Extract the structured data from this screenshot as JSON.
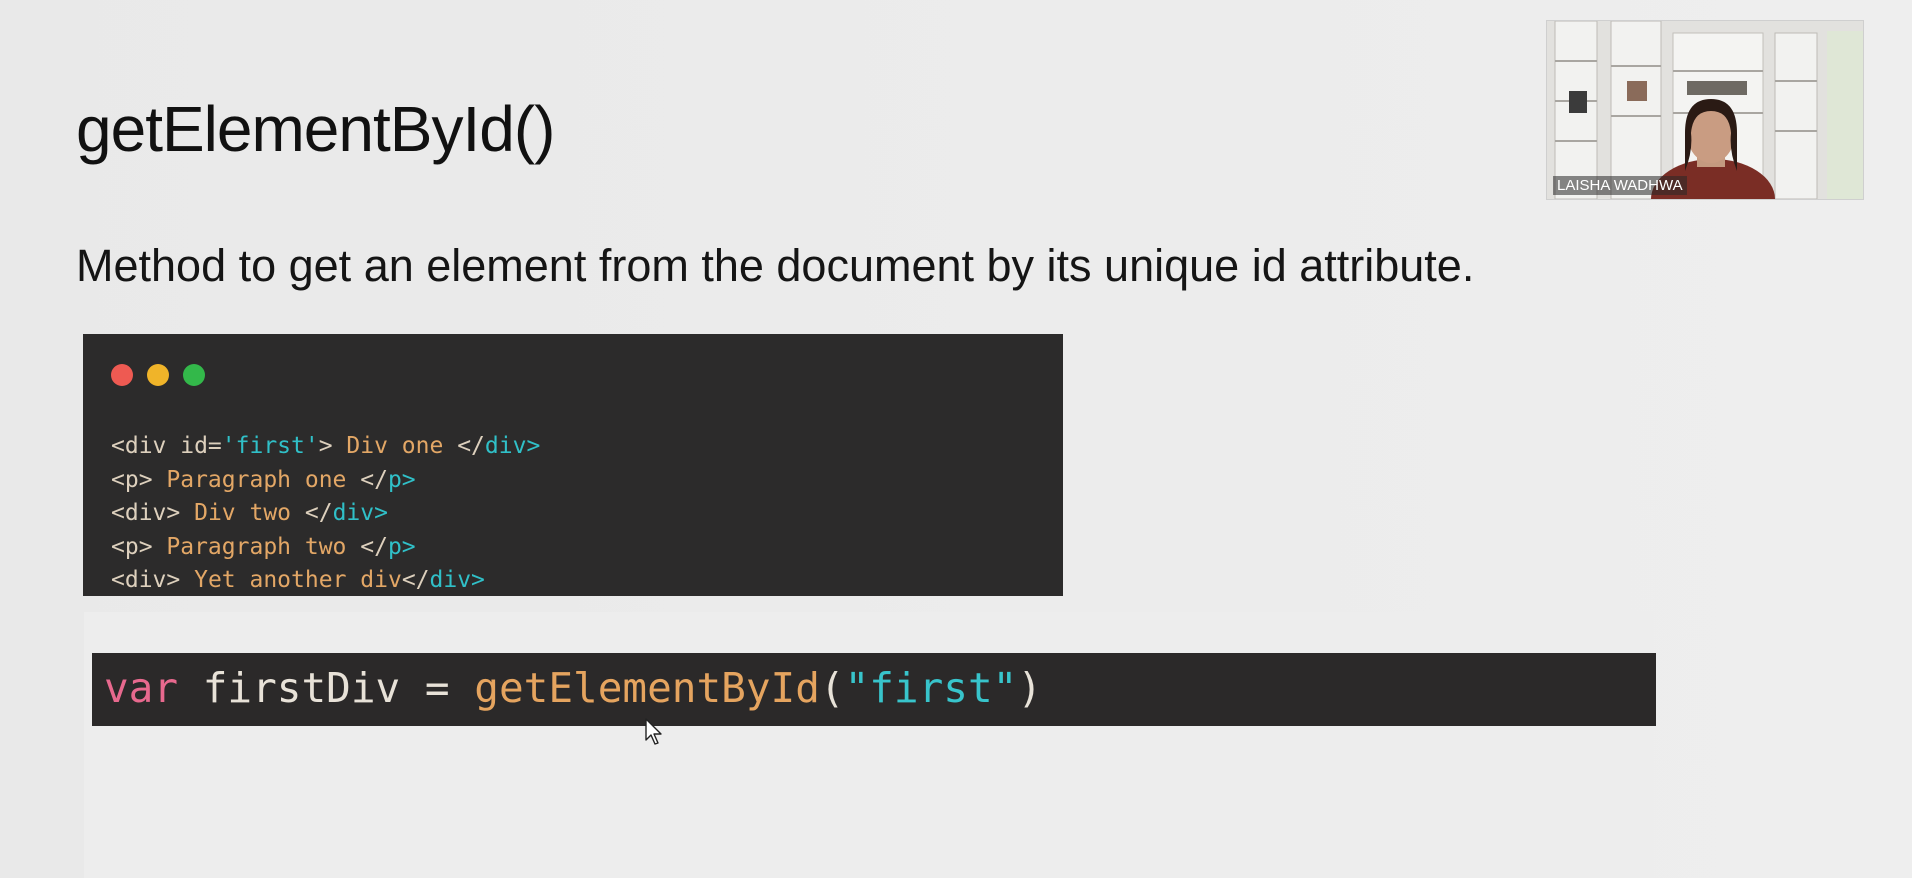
{
  "slide": {
    "title": "getElementById()",
    "subtitle": "Method to get an element from the document by its unique id attribute."
  },
  "code_window": {
    "lines": [
      [
        {
          "t": "<div id=",
          "c": "plain"
        },
        {
          "t": "'first'",
          "c": "str"
        },
        {
          "t": "> ",
          "c": "plain"
        },
        {
          "t": "Div one",
          "c": "txt"
        },
        {
          "t": " </",
          "c": "plain"
        },
        {
          "t": "div>",
          "c": "tag"
        }
      ],
      [
        {
          "t": "<p> ",
          "c": "plain"
        },
        {
          "t": "Paragraph one",
          "c": "txt"
        },
        {
          "t": " </",
          "c": "plain"
        },
        {
          "t": "p>",
          "c": "tag"
        }
      ],
      [
        {
          "t": "<div> ",
          "c": "plain"
        },
        {
          "t": "Div two",
          "c": "txt"
        },
        {
          "t": " </",
          "c": "plain"
        },
        {
          "t": "div>",
          "c": "tag"
        }
      ],
      [
        {
          "t": "<p> ",
          "c": "plain"
        },
        {
          "t": "Paragraph two",
          "c": "txt"
        },
        {
          "t": " </",
          "c": "plain"
        },
        {
          "t": "p>",
          "c": "tag"
        }
      ],
      [
        {
          "t": "<div> ",
          "c": "plain"
        },
        {
          "t": "Yet another div",
          "c": "txt"
        },
        {
          "t": "</",
          "c": "plain"
        },
        {
          "t": "div>",
          "c": "tag"
        }
      ]
    ]
  },
  "code_bar": {
    "keyword": "var",
    "variable": "firstDiv",
    "operator": "=",
    "function": "getElementById",
    "open_paren": "(",
    "argument": "\"first\"",
    "close_paren": ")"
  },
  "video": {
    "participant_name": "LAISHA WADHWA"
  },
  "colors": {
    "background": "#ebebeb",
    "code_bg": "#2c2b2b",
    "dot_red": "#ee5a52",
    "dot_yellow": "#f0b429",
    "dot_green": "#33b84a",
    "keyword": "#e8698e",
    "string": "#38c4cb",
    "function": "#e5a45f"
  },
  "icons": {
    "cursor": "mouse-pointer-icon"
  }
}
